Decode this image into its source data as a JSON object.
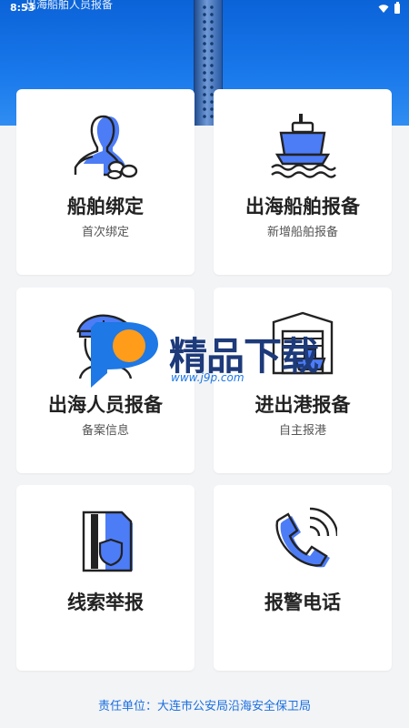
{
  "statusbar": {
    "time": "8:53",
    "title": "出海船舶人员报备"
  },
  "cards": [
    {
      "title": "船舶绑定",
      "subtitle": "首次绑定",
      "icon": "person-chain-icon"
    },
    {
      "title": "出海船舶报备",
      "subtitle": "新增船舶报备",
      "icon": "ship-icon"
    },
    {
      "title": "出海人员报备",
      "subtitle": "备案信息",
      "icon": "sailor-icon"
    },
    {
      "title": "进出港报备",
      "subtitle": "自主报港",
      "icon": "port-garage-icon"
    },
    {
      "title": "线索举报",
      "subtitle": "",
      "icon": "document-shield-icon"
    },
    {
      "title": "报警电话",
      "subtitle": "",
      "icon": "phone-icon"
    }
  ],
  "footer": {
    "text": "责任单位：大连市公安局沿海安全保卫局"
  },
  "watermark": {
    "text": "精品下载",
    "url": "www.j9p.com"
  },
  "colors": {
    "accent": "#4d7cf7",
    "header": "#1877ea",
    "footer_text": "#1a6fe0"
  }
}
